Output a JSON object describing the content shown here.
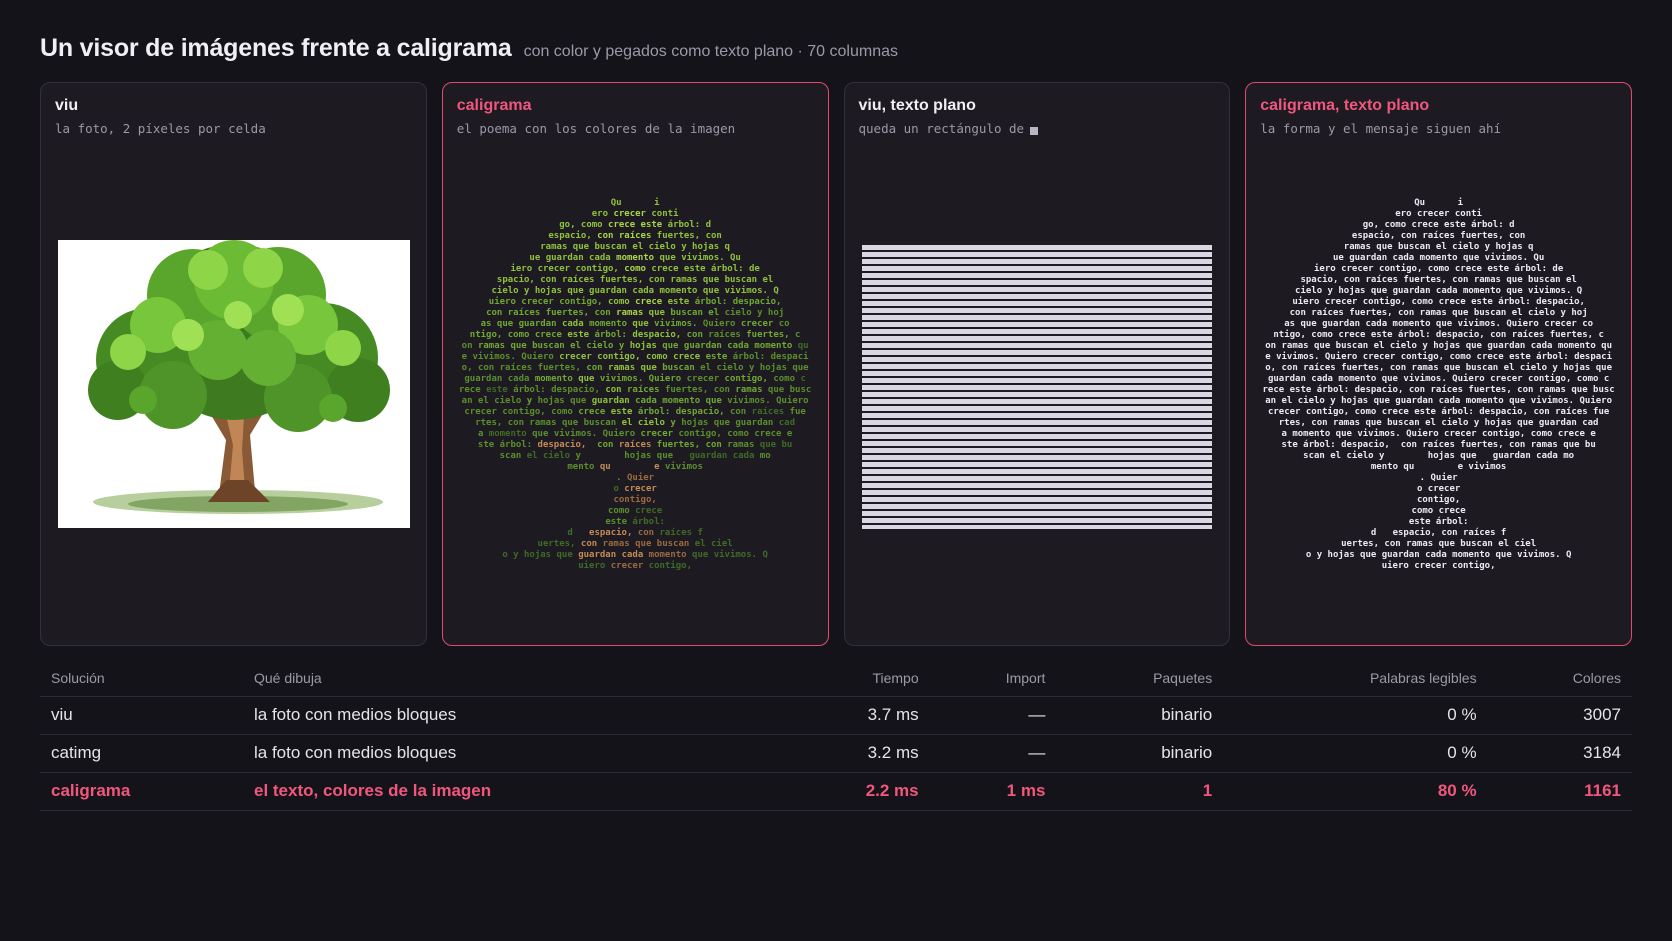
{
  "header": {
    "title": "Un visor de imágenes frente a caligrama",
    "subtitle": "con color y pegados como texto plano · 70 columnas"
  },
  "panels": [
    {
      "title": "viu",
      "desc": "la foto, 2 píxeles por celda"
    },
    {
      "title": "caligrama",
      "desc": "el poema con los colores de la imagen"
    },
    {
      "title": "viu, texto plano",
      "desc": "queda un rectángulo de"
    },
    {
      "title": "caligrama, texto plano",
      "desc": "la forma y el mensaje siguen ahí"
    }
  ],
  "calligram_lines": [
    "Qu      i",
    "ero crecer conti",
    "go, como crece este árbol: d",
    "espacio, con raíces fuertes, con",
    "ramas que buscan el cielo y hojas q",
    "ue guardan cada momento que vivimos. Qu",
    "iero crecer contigo, como crece este árbol: de",
    "spacio, con raíces fuertes, con ramas que buscan el",
    "cielo y hojas que guardan cada momento que vivimos. Q",
    "uiero crecer contigo, como crece este árbol: despacio,",
    "con raíces fuertes, con ramas que buscan el cielo y hoj",
    "as que guardan cada momento que vivimos. Quiero crecer co",
    "ntigo, como crece este árbol: despacio, con raíces fuertes, c",
    "on ramas que buscan el cielo y hojas que guardan cada momento qu",
    "e vivimos. Quiero crecer contigo, como crece este árbol: despaci",
    "o, con raíces fuertes, con ramas que buscan el cielo y hojas que",
    "guardan cada momento que vivimos. Quiero crecer contigo, como c",
    "rece este árbol: despacio, con raíces fuertes, con ramas que busc",
    "an el cielo y hojas que guardan cada momento que vivimos. Quiero",
    "crecer contigo, como crece este árbol: despacio, con raíces fue",
    "rtes, con ramas que buscan el cielo y hojas que guardan cad",
    "a momento que vivimos. Quiero crecer contigo, como crece e",
    "ste árbol: despacio,  con raíces fuertes, con ramas que bu",
    "scan el cielo y        hojas que   guardan cada mo",
    "mento qu        e vivimos",
    ". Quier",
    "o crecer",
    "contigo,",
    "como crece",
    "este árbol:",
    "d   espacio, con raíces f",
    "uertes, con ramas que buscan el ciel",
    "o y hojas que guardan cada momento que vivimos. Q",
    "uiero crecer contigo,"
  ],
  "calligram_colors": [
    "#a8d648",
    "#8fc23c",
    "#6fa832",
    "#5a8f2b",
    "#3f6b24",
    "#c48a55",
    "#9a6a3f"
  ],
  "table": {
    "headers": [
      "Solución",
      "Qué dibuja",
      "Tiempo",
      "Import",
      "Paquetes",
      "Palabras legibles",
      "Colores"
    ],
    "rows": [
      [
        "viu",
        "la foto con medios bloques",
        "3.7 ms",
        "—",
        "binario",
        "0 %",
        "3007"
      ],
      [
        "catimg",
        "la foto con medios bloques",
        "3.2 ms",
        "—",
        "binario",
        "0 %",
        "3184"
      ],
      [
        "caligrama",
        "el texto, colores de la imagen",
        "2.2 ms",
        "1 ms",
        "1",
        "80 %",
        "1161"
      ]
    ]
  },
  "colors": {
    "accent": "#f0577d",
    "background": "#15131a",
    "panel": "#1d1a22"
  },
  "icons": [
    "tree-image",
    "block-square-icon"
  ]
}
